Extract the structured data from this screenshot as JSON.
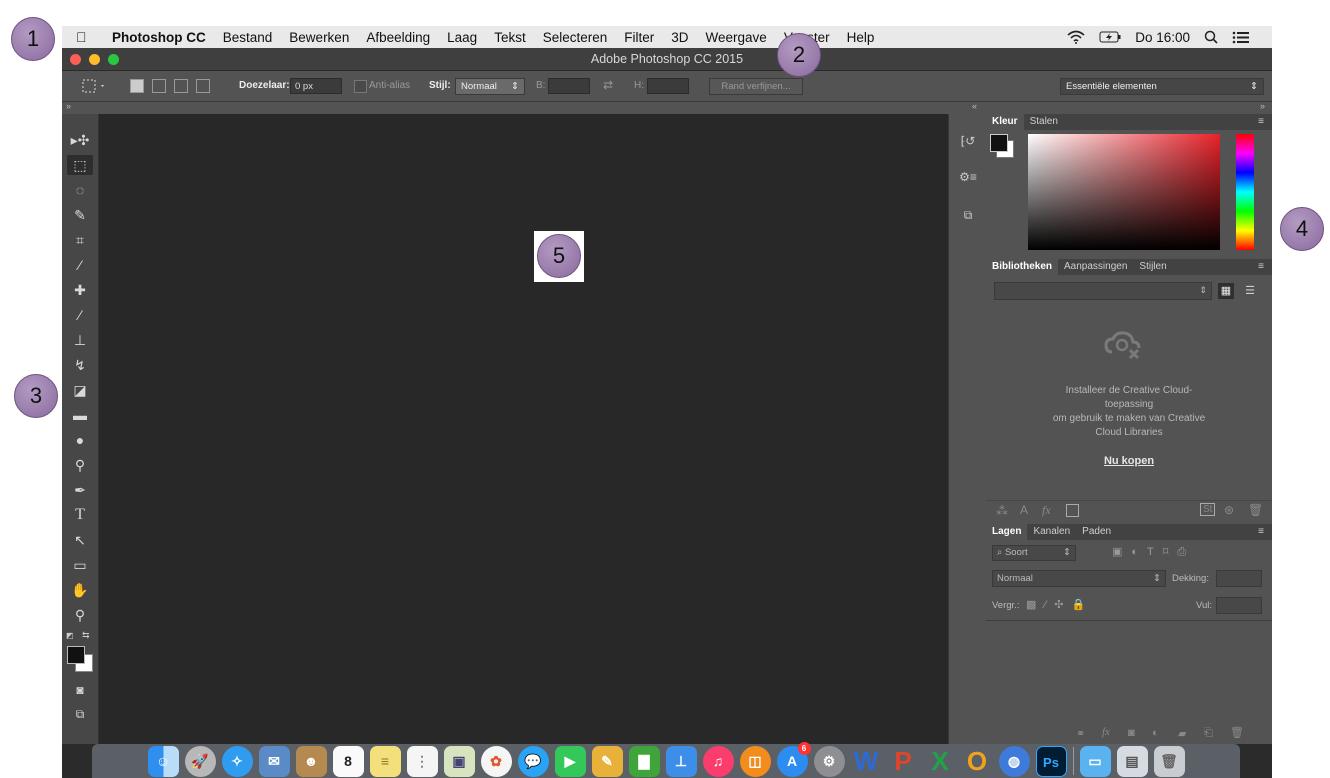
{
  "menubar": {
    "app_name": "Photoshop CC",
    "items": [
      "Bestand",
      "Bewerken",
      "Afbeelding",
      "Laag",
      "Tekst",
      "Selecteren",
      "Filter",
      "3D",
      "Weergave",
      "Venster",
      "Help"
    ],
    "clock": "Do 16:00"
  },
  "window": {
    "title": "Adobe Photoshop CC 2015"
  },
  "options_bar": {
    "doezelaar_label": "Doezelaar:",
    "doezelaar_value": "0 px",
    "anti_alias_label": "Anti-alias",
    "stijl_label": "Stijl:",
    "stijl_value": "Normaal",
    "b_label": "B:",
    "h_label": "H:",
    "refine_button": "Rand verfijnen...",
    "workspace": "Essentiële elementen"
  },
  "color_panel": {
    "tabs": [
      "Kleur",
      "Stalen"
    ]
  },
  "libraries_panel": {
    "tabs": [
      "Bibliotheken",
      "Aanpassingen",
      "Stijlen"
    ],
    "message_line1": "Installeer de Creative Cloud-",
    "message_line2": "toepassing",
    "message_line3": "om gebruik te maken van Creative",
    "message_line4": "Cloud Libraries",
    "buy_link": "Nu kopen"
  },
  "layers_panel": {
    "tabs": [
      "Lagen",
      "Kanalen",
      "Paden"
    ],
    "filter_label": "Soort",
    "blend_mode": "Normaal",
    "opacity_label": "Dekking:",
    "lock_label": "Vergr.:",
    "fill_label": "Vul:"
  },
  "dock": {
    "ps_label": "Ps",
    "calendar_day": "8",
    "badge_count": "6"
  },
  "callouts": [
    "1",
    "2",
    "3",
    "4",
    "5"
  ],
  "colors": {
    "canvas": "#282828",
    "panel": "#535353",
    "callout": "#9a7bb0"
  }
}
